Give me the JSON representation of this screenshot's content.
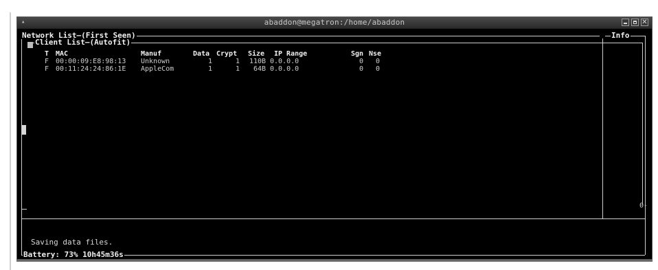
{
  "window": {
    "title": "abaddon@megatron:/home/abaddon",
    "menu_icon": "window-menu-icon",
    "close_glyph": "✕"
  },
  "panels": {
    "network_list_label": "Network List—(First Seen)",
    "client_list_label": "Client List—(Autofit)",
    "info_label": "Info",
    "info_side_mark": "0-"
  },
  "client_table": {
    "columns": {
      "type": "T",
      "mac": "MAC",
      "manuf": "Manuf",
      "data": "Data",
      "crypt": "Crypt",
      "size": "Size",
      "ip_range": "IP Range",
      "sgn": "Sgn",
      "nse": "Nse"
    },
    "rows": [
      {
        "type": "F",
        "mac": "00:00:09:E8:98:13",
        "manuf": "Unknown",
        "data": "1",
        "crypt": "1",
        "size": "110B",
        "ip_range": "0.0.0.0",
        "sgn": "0",
        "nse": "0"
      },
      {
        "type": "F",
        "mac": "00:11:24:24:86:1E",
        "manuf": "AppleCom",
        "data": "1",
        "crypt": "1",
        "size": "64B",
        "ip_range": "0.0.0.0",
        "sgn": "0",
        "nse": "0"
      }
    ]
  },
  "status": {
    "message": "Saving data files.",
    "battery": "Battery: 73% 10h45m36s"
  },
  "colors": {
    "terminal_bg": "#000000",
    "terminal_fg": "#d8d8d8",
    "frame_line": "#d0d0d0"
  }
}
